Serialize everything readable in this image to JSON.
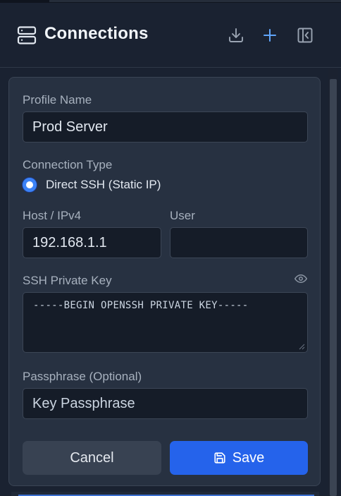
{
  "header": {
    "title": "Connections",
    "icons": {
      "logo": "server-icon",
      "download": "download-icon",
      "add": "plus-icon",
      "collapse": "collapse-sidebar-icon"
    }
  },
  "form": {
    "profile_name": {
      "label": "Profile Name",
      "value": "Prod Server"
    },
    "connection_type": {
      "label": "Connection Type",
      "option": "Direct SSH (Static IP)",
      "selected": true
    },
    "host": {
      "label": "Host / IPv4",
      "value": "192.168.1.1"
    },
    "user": {
      "label": "User",
      "value": ""
    },
    "ssh_key": {
      "label": "SSH Private Key",
      "value": "-----BEGIN OPENSSH PRIVATE KEY-----",
      "toggle_icon": "eye-icon"
    },
    "passphrase": {
      "label": "Passphrase (Optional)",
      "placeholder": "Key Passphrase"
    }
  },
  "actions": {
    "cancel_label": "Cancel",
    "save_label": "Save",
    "save_icon": "save-icon"
  },
  "colors": {
    "accent": "#2563eb",
    "background": "#1a2231",
    "card": "#273141",
    "input": "#151c28"
  }
}
